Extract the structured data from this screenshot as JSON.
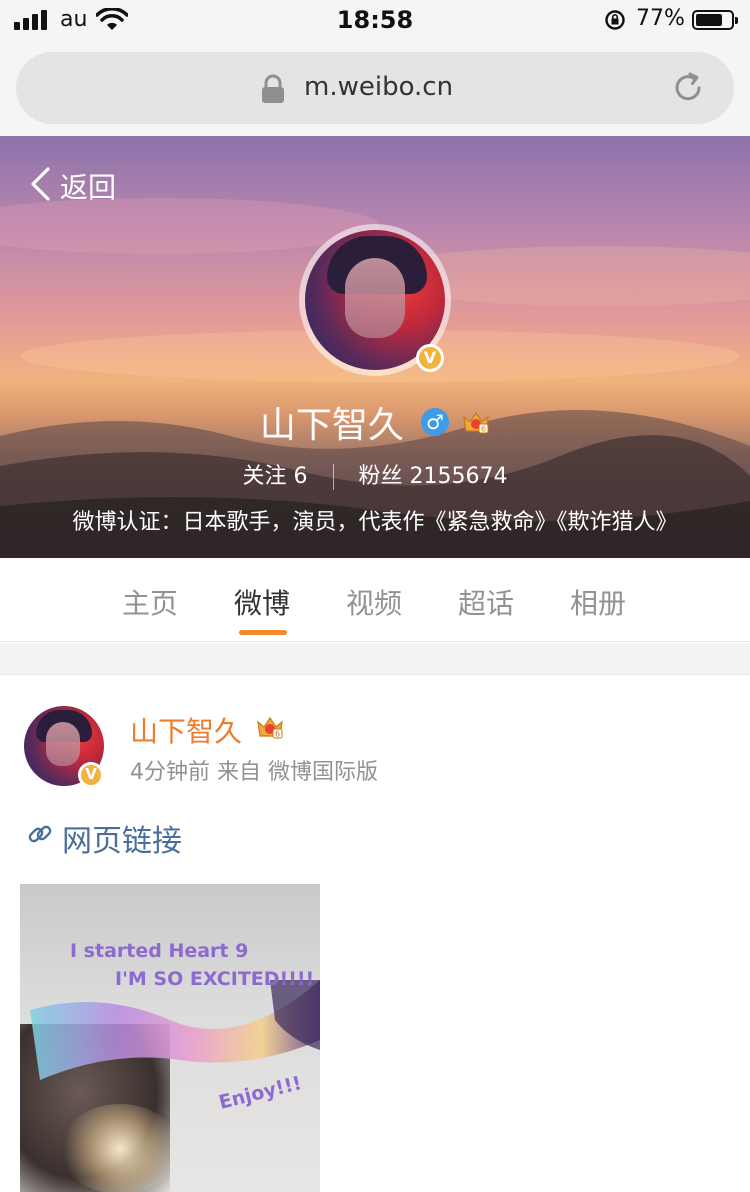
{
  "status_bar": {
    "carrier": "au",
    "time": "18:58",
    "battery_percent": "77%",
    "battery_level": 0.77
  },
  "browser": {
    "url": "m.weibo.cn"
  },
  "profile": {
    "back_label": "返回",
    "name": "山下智久",
    "gender_symbol": "♂",
    "verified_badge": "V",
    "stats_text": "关注  6",
    "followers_text": "粉丝  2155674",
    "verification": "微博认证：日本歌手，演员，代表作《紧急救命》《欺诈猎人》",
    "crown_level": "6"
  },
  "tabs": [
    {
      "label": "主页"
    },
    {
      "label": "微博"
    },
    {
      "label": "视频"
    },
    {
      "label": "超话"
    },
    {
      "label": "相册"
    }
  ],
  "active_tab": "微博",
  "post": {
    "author": "山下智久",
    "meta": "4分钟前  来自  微博国际版",
    "link_text": "网页链接",
    "image_lines": [
      "I started Heart 9",
      "I'M SO EXCITED!!!!",
      "Enjoy!!!"
    ]
  },
  "colors": {
    "accent_orange": "#f08a2e",
    "name_orange": "#f07b2a",
    "link_blue": "#4a6f9a",
    "verified_gold": "#f2b33d",
    "gender_blue": "#3f9ae8"
  },
  "icons": [
    "signal-icon",
    "wifi-icon",
    "rotation-lock-icon",
    "battery-icon",
    "padlock-icon",
    "reload-icon",
    "back-chevron-icon",
    "male-icon",
    "crown-icon",
    "verified-icon",
    "link-icon"
  ]
}
